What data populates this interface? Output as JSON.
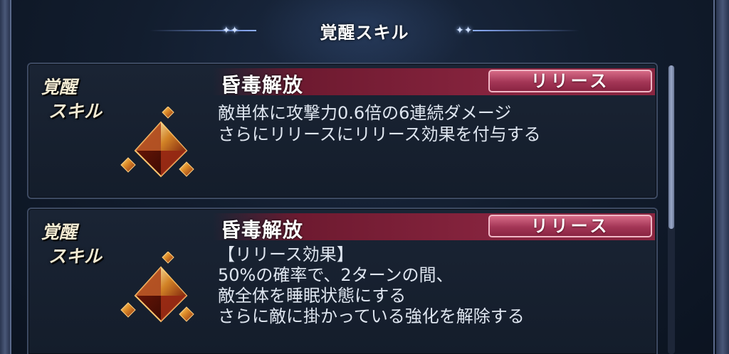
{
  "header": {
    "title": "覚醒スキル"
  },
  "skills": [
    {
      "label_line1": "覚醒",
      "label_line2": "スキル",
      "name": "昏毒解放",
      "release_label": "リリース",
      "description": "敵単体に攻撃力0.6倍の6連続ダメージ\nさらにリリースにリリース効果を付与する",
      "icon": "crystal-pyramid-icon"
    },
    {
      "label_line1": "覚醒",
      "label_line2": "スキル",
      "name": "昏毒解放",
      "release_label": "リリース",
      "description": "【リリース効果】\n50%の確率で、2ターンの間、\n敵全体を睡眠状態にする\nさらに敵に掛かっている強化を解除する",
      "icon": "crystal-pyramid-icon"
    }
  ],
  "colors": {
    "name_bar": "#8a2540",
    "release_button": "#a33656",
    "panel_bg": "#1a2434",
    "label_text": "#f2ead2"
  }
}
